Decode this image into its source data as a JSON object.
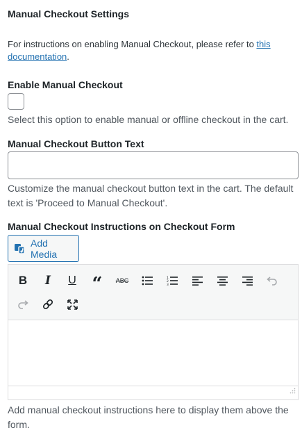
{
  "section": {
    "title": "Manual Checkout Settings"
  },
  "intro": {
    "text": "For instructions on enabling Manual Checkout, please refer to ",
    "link_text": "this documentation",
    "suffix": "."
  },
  "enable": {
    "label": "Enable Manual Checkout",
    "checked": false,
    "help": "Select this option to enable manual or offline checkout in the cart."
  },
  "button_text": {
    "label": "Manual Checkout Button Text",
    "value": "",
    "help": "Customize the manual checkout button text in the cart. The default text is 'Proceed to Manual Checkout'."
  },
  "instructions": {
    "label": "Manual Checkout Instructions on Checkout Form",
    "add_media_label": "Add Media",
    "toolbar_row1": [
      "bold-icon",
      "italic-icon",
      "underline-icon",
      "blockquote-icon",
      "strikethrough-icon",
      "bullet-list-icon",
      "numbered-list-icon",
      "align-left-icon",
      "align-center-icon",
      "align-right-icon",
      "undo-icon"
    ],
    "toolbar_row2": [
      "redo-icon",
      "link-icon",
      "fullscreen-icon"
    ],
    "content": "",
    "help": "Add manual checkout instructions here to display them above the form."
  },
  "colors": {
    "link": "#2271b1",
    "text": "#1d2327",
    "help_text": "#50575e",
    "border": "#8c8f94",
    "toolbar_bg": "#f6f7f7"
  }
}
